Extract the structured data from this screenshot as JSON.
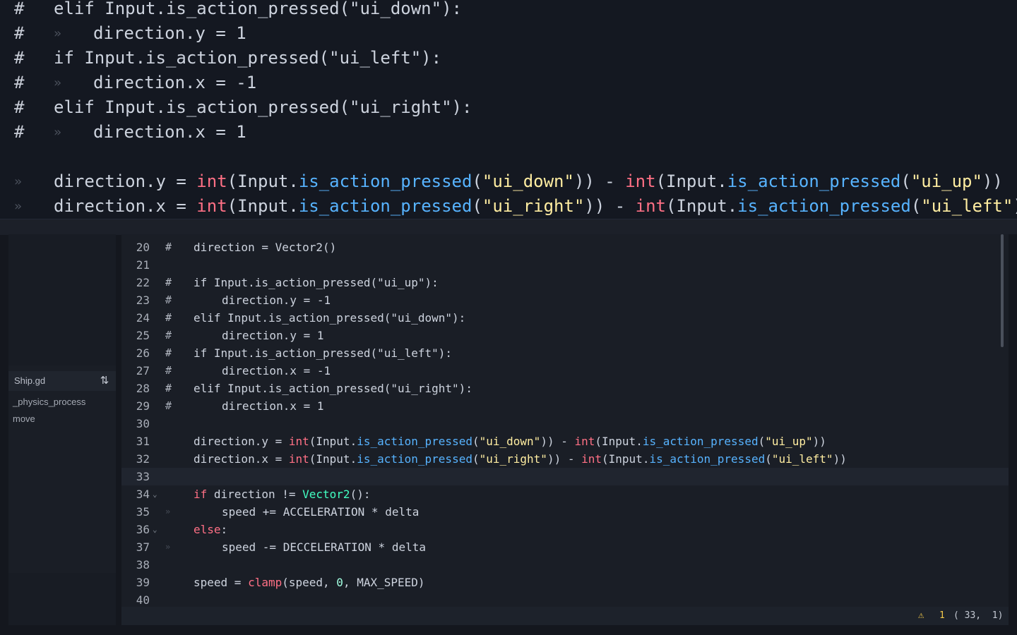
{
  "zoom": {
    "lines": [
      {
        "comment": "#",
        "parts": [
          {
            "t": "elif Input.is_action_pressed(\"ui_down\"):",
            "c": "id"
          }
        ]
      },
      {
        "comment": "#",
        "indent": 1,
        "parts": [
          {
            "t": "direction.y = 1",
            "c": "id"
          }
        ]
      },
      {
        "comment": "#",
        "parts": [
          {
            "t": "if Input.is_action_pressed(\"ui_left\"):",
            "c": "id"
          }
        ]
      },
      {
        "comment": "#",
        "indent": 1,
        "parts": [
          {
            "t": "direction.x = -1",
            "c": "id"
          }
        ]
      },
      {
        "comment": "#",
        "parts": [
          {
            "t": "elif Input.is_action_pressed(\"ui_right\"):",
            "c": "id"
          }
        ]
      },
      {
        "comment": "#",
        "indent": 1,
        "parts": [
          {
            "t": "direction.x = 1",
            "c": "id"
          }
        ]
      },
      {
        "comment": "",
        "parts": []
      },
      {
        "comment": "",
        "parts": [
          {
            "t": "direction.y = ",
            "c": "id"
          },
          {
            "t": "int",
            "c": "kw"
          },
          {
            "t": "(Input.",
            "c": "id"
          },
          {
            "t": "is_action_pressed",
            "c": "fn"
          },
          {
            "t": "(",
            "c": "id"
          },
          {
            "t": "\"ui_down\"",
            "c": "str"
          },
          {
            "t": ")) - ",
            "c": "id"
          },
          {
            "t": "int",
            "c": "kw"
          },
          {
            "t": "(Input.",
            "c": "id"
          },
          {
            "t": "is_action_pressed",
            "c": "fn"
          },
          {
            "t": "(",
            "c": "id"
          },
          {
            "t": "\"ui_up\"",
            "c": "str"
          },
          {
            "t": "))",
            "c": "id"
          }
        ]
      },
      {
        "comment": "",
        "parts": [
          {
            "t": "direction.x = ",
            "c": "id"
          },
          {
            "t": "int",
            "c": "kw"
          },
          {
            "t": "(Input.",
            "c": "id"
          },
          {
            "t": "is_action_pressed",
            "c": "fn"
          },
          {
            "t": "(",
            "c": "id"
          },
          {
            "t": "\"ui_right\"",
            "c": "str"
          },
          {
            "t": ")) - ",
            "c": "id"
          },
          {
            "t": "int",
            "c": "kw"
          },
          {
            "t": "(Input.",
            "c": "id"
          },
          {
            "t": "is_action_pressed",
            "c": "fn"
          },
          {
            "t": "(",
            "c": "id"
          },
          {
            "t": "\"ui_left\"",
            "c": "str"
          },
          {
            "t": "))",
            "c": "id"
          }
        ]
      }
    ]
  },
  "script_panel": {
    "script_name": "Ship.gd",
    "sort_icon": "sort-icon",
    "methods": [
      "_physics_process",
      "move"
    ]
  },
  "editor": {
    "lines": [
      {
        "n": "20",
        "comment": "#",
        "parts": [
          {
            "t": "direction = Vector2()",
            "c": "id"
          }
        ]
      },
      {
        "n": "21",
        "parts": []
      },
      {
        "n": "22",
        "comment": "#",
        "parts": [
          {
            "t": "if Input.is_action_pressed(\"ui_up\"):",
            "c": "id"
          }
        ]
      },
      {
        "n": "23",
        "comment": "#",
        "indent": 1,
        "parts": [
          {
            "t": "direction.y = -1",
            "c": "id"
          }
        ]
      },
      {
        "n": "24",
        "comment": "#",
        "parts": [
          {
            "t": "elif Input.is_action_pressed(\"ui_down\"):",
            "c": "id"
          }
        ]
      },
      {
        "n": "25",
        "comment": "#",
        "indent": 1,
        "parts": [
          {
            "t": "direction.y = 1",
            "c": "id"
          }
        ]
      },
      {
        "n": "26",
        "comment": "#",
        "parts": [
          {
            "t": "if Input.is_action_pressed(\"ui_left\"):",
            "c": "id"
          }
        ]
      },
      {
        "n": "27",
        "comment": "#",
        "indent": 1,
        "parts": [
          {
            "t": "direction.x = -1",
            "c": "id"
          }
        ]
      },
      {
        "n": "28",
        "comment": "#",
        "parts": [
          {
            "t": "elif Input.is_action_pressed(\"ui_right\"):",
            "c": "id"
          }
        ]
      },
      {
        "n": "29",
        "comment": "#",
        "indent": 1,
        "parts": [
          {
            "t": "direction.x = 1",
            "c": "id"
          }
        ]
      },
      {
        "n": "30",
        "parts": []
      },
      {
        "n": "31",
        "parts": [
          {
            "t": "direction.y = ",
            "c": "id"
          },
          {
            "t": "int",
            "c": "kw"
          },
          {
            "t": "(Input.",
            "c": "id"
          },
          {
            "t": "is_action_pressed",
            "c": "fn"
          },
          {
            "t": "(",
            "c": "id"
          },
          {
            "t": "\"ui_down\"",
            "c": "str"
          },
          {
            "t": ")) - ",
            "c": "id"
          },
          {
            "t": "int",
            "c": "kw"
          },
          {
            "t": "(Input.",
            "c": "id"
          },
          {
            "t": "is_action_pressed",
            "c": "fn"
          },
          {
            "t": "(",
            "c": "id"
          },
          {
            "t": "\"ui_up\"",
            "c": "str"
          },
          {
            "t": "))",
            "c": "id"
          }
        ]
      },
      {
        "n": "32",
        "parts": [
          {
            "t": "direction.x = ",
            "c": "id"
          },
          {
            "t": "int",
            "c": "kw"
          },
          {
            "t": "(Input.",
            "c": "id"
          },
          {
            "t": "is_action_pressed",
            "c": "fn"
          },
          {
            "t": "(",
            "c": "id"
          },
          {
            "t": "\"ui_right\"",
            "c": "str"
          },
          {
            "t": ")) - ",
            "c": "id"
          },
          {
            "t": "int",
            "c": "kw"
          },
          {
            "t": "(Input.",
            "c": "id"
          },
          {
            "t": "is_action_pressed",
            "c": "fn"
          },
          {
            "t": "(",
            "c": "id"
          },
          {
            "t": "\"ui_left\"",
            "c": "str"
          },
          {
            "t": "))",
            "c": "id"
          }
        ]
      },
      {
        "n": "33",
        "current": true,
        "parts": []
      },
      {
        "n": "34",
        "fold": true,
        "parts": [
          {
            "t": "if",
            "c": "kw"
          },
          {
            "t": " direction != ",
            "c": "id"
          },
          {
            "t": "Vector2",
            "c": "ty"
          },
          {
            "t": "():",
            "c": "id"
          }
        ]
      },
      {
        "n": "35",
        "indent": 1,
        "parts": [
          {
            "t": "speed += ACCELERATION * delta",
            "c": "id"
          }
        ]
      },
      {
        "n": "36",
        "fold": true,
        "parts": [
          {
            "t": "else",
            "c": "kw"
          },
          {
            "t": ":",
            "c": "id"
          }
        ]
      },
      {
        "n": "37",
        "indent": 1,
        "parts": [
          {
            "t": "speed -= DECCELERATION * delta",
            "c": "id"
          }
        ]
      },
      {
        "n": "38",
        "parts": []
      },
      {
        "n": "39",
        "parts": [
          {
            "t": "speed = ",
            "c": "id"
          },
          {
            "t": "clamp",
            "c": "kw"
          },
          {
            "t": "(speed, ",
            "c": "id"
          },
          {
            "t": "0",
            "c": "num"
          },
          {
            "t": ", MAX_SPEED)",
            "c": "id"
          }
        ]
      },
      {
        "n": "40",
        "parts": []
      }
    ]
  },
  "status": {
    "warning_icon": "warning-icon",
    "warning_glyph": "⚠",
    "warning_count": "1",
    "cursor_position": "( 33,  1)"
  }
}
